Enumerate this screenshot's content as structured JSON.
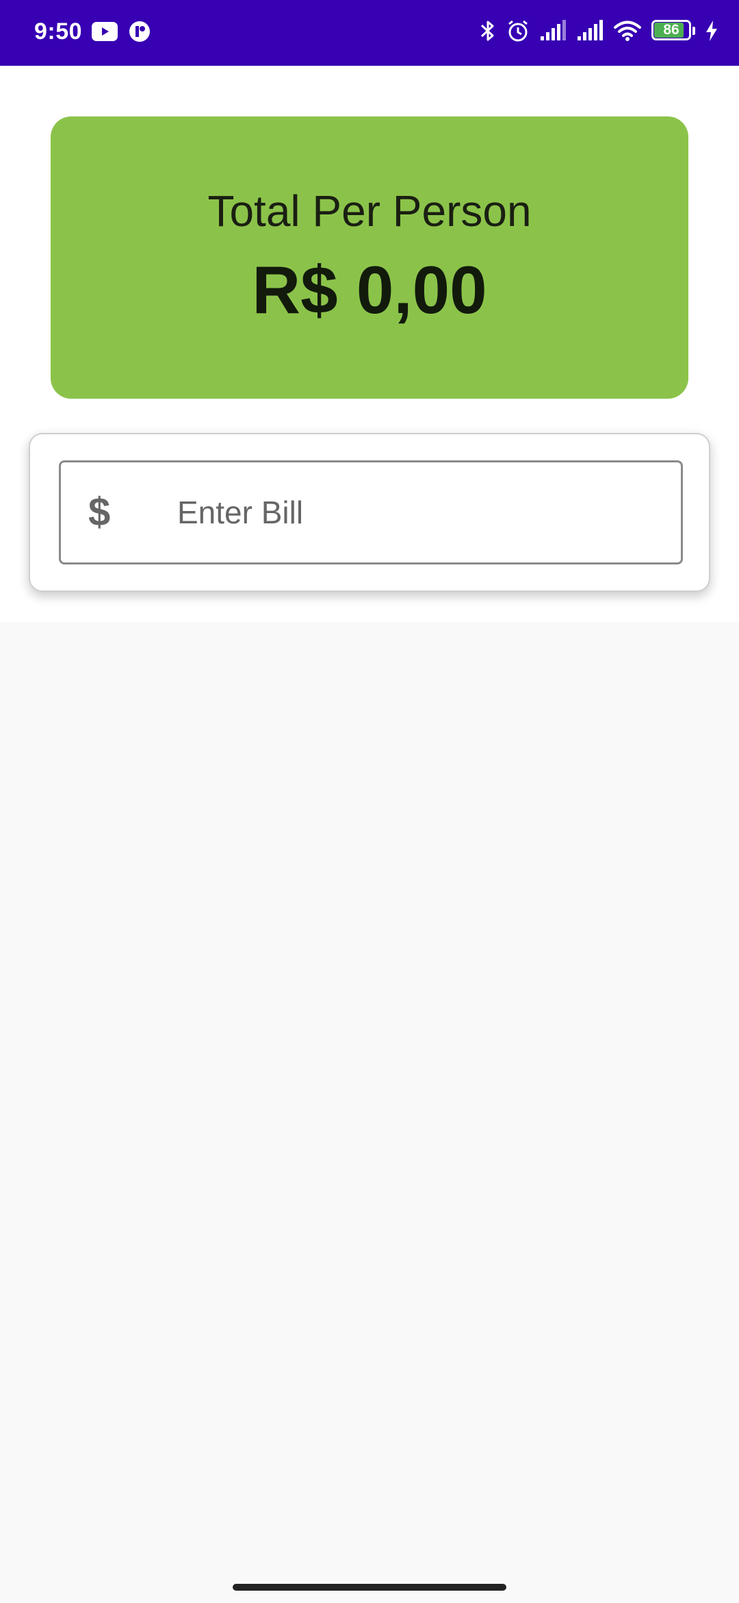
{
  "status_bar": {
    "time": "9:50",
    "background": "#3700b3",
    "left_icons": [
      "youtube-icon",
      "app-notification-icon"
    ],
    "right_icons": [
      "bluetooth-icon",
      "alarm-icon",
      "signal-icon",
      "signal-icon",
      "wifi-icon",
      "battery-icon",
      "charging-icon"
    ],
    "battery_level": "86"
  },
  "total_card": {
    "label": "Total Per Person",
    "amount": "R$ 0,00",
    "background": "#8bc34a"
  },
  "bill_input": {
    "icon": "dollar-icon",
    "icon_glyph": "$",
    "placeholder": "Enter Bill"
  }
}
